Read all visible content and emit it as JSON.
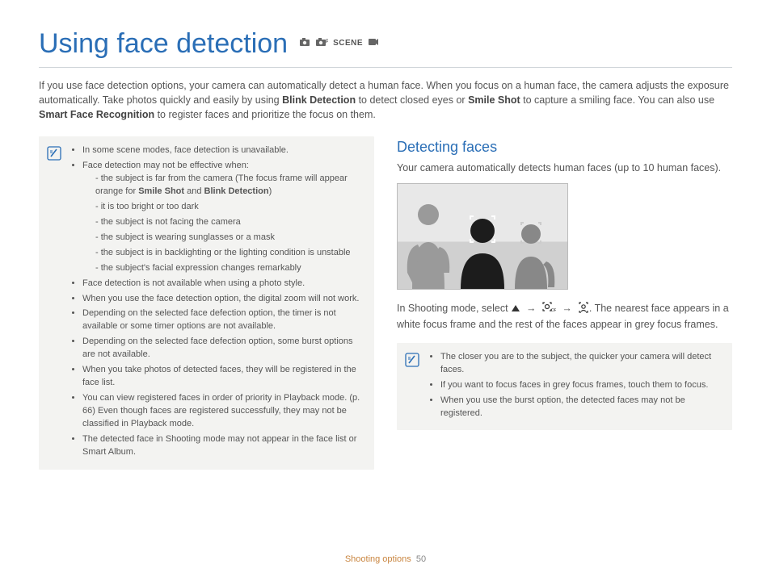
{
  "page_title": "Using face detection",
  "intro_parts": {
    "p1": "If you use face detection options, your camera can automatically detect a human face. When you focus on a human face, the camera adjusts the exposure automatically. Take photos quickly and easily by using ",
    "b1": "Blink Detection",
    "p2": " to detect closed eyes or ",
    "b2": "Smile Shot",
    "p3": " to capture a smiling face. You can also use ",
    "b3": "Smart Face Recognition",
    "p4": " to register faces and prioritize the focus on them."
  },
  "left_notes": {
    "items": [
      "In some scene modes, face detection is unavailable.",
      "Face detection may not be effective when:",
      "Face detection is not available when using a photo style.",
      "When you use the face detection option, the digital zoom will not work.",
      "Depending on the selected face defection option, the timer is not available or some timer options are not available.",
      "Depending on the selected face defection option, some burst options are not available.",
      "When you take photos of detected faces, they will be registered in the face list.",
      "You can view registered faces in order of priority in Playback mode. (p. 66) Even though faces are registered successfully, they may not be classified in Playback mode.",
      "The detected face in Shooting mode may not appear in the face list or Smart Album."
    ],
    "sub_items_prefix": "the subject is far from the camera (The focus frame will appear orange for ",
    "sub_b1": "Smile Shot",
    "sub_mid": " and ",
    "sub_b2": "Blink Detection",
    "sub_suffix": ")",
    "sub_rest": [
      "it is too bright or too dark",
      "the subject is not facing the camera",
      "the subject is wearing sunglasses or a mask",
      "the subject is in backlighting or the lighting condition is unstable",
      "the subject's facial expression changes remarkably"
    ]
  },
  "right": {
    "heading": "Detecting faces",
    "lead": "Your camera automatically detects human faces (up to 10 human faces).",
    "step_pre": "In Shooting mode, select ",
    "step_post": ". The nearest face appears in a white focus frame and the rest of the faces appear in grey focus frames.",
    "notes": [
      "The closer you are to the subject, the quicker your camera will detect faces.",
      "If you want to focus faces in grey focus frames, touch them to focus.",
      "When you use the burst option, the detected faces may not be registered."
    ]
  },
  "footer": {
    "section": "Shooting options",
    "page": "50"
  },
  "mode_icons": [
    "camera-icon",
    "camera-plus-icon",
    "SCENE",
    "video-icon"
  ]
}
